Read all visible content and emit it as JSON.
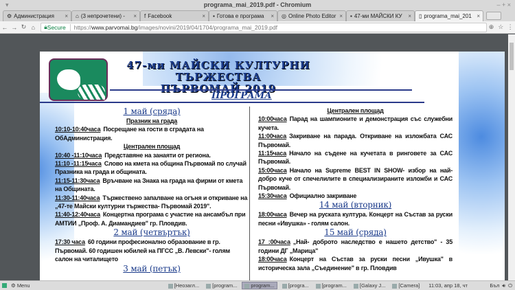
{
  "window": {
    "title": "programa_mai_2019.pdf - Chromium",
    "controls": "– + ×"
  },
  "tabs": [
    {
      "label": "Администрация",
      "icon": "gear-icon"
    },
    {
      "label": "(3 непрочетени) - ",
      "icon": "home-icon"
    },
    {
      "label": "Facebook",
      "icon": "facebook-icon"
    },
    {
      "label": "Готова е програма",
      "icon": "page-icon"
    },
    {
      "label": "Online Photo Editor",
      "icon": "globe-icon"
    },
    {
      "label": "47-ми МАЙСКИ КУ",
      "icon": "page-icon"
    },
    {
      "label": "programa_mai_201",
      "icon": "document-icon",
      "active": true
    }
  ],
  "address": {
    "secure": "Secure",
    "url_scheme": "https://",
    "url_host": "www.parvomai.bg",
    "url_path": "/images/novini/2019/04/1704/programa_mai_2019.pdf"
  },
  "pdf": {
    "heading1": "47-ми МАЙСКИ КУЛТУРНИ ТЪРЖЕСТВА",
    "heading2": "ПЪРВОМАЙ 2019",
    "program": "ПРОГРАМА",
    "left": [
      {
        "type": "day",
        "text": "1 май  (сряда)"
      },
      {
        "type": "sub",
        "text": "Празник на града"
      },
      {
        "type": "item",
        "time": "10:10-10:40часа",
        "text": "Посрещане на гости в сградата на ОбАдминистрация."
      },
      {
        "type": "sub",
        "text": "Централен площад"
      },
      {
        "type": "item",
        "time": "10:40 -11:10часа",
        "text": "Представяне на занаяти от региона."
      },
      {
        "type": "item",
        "time": "11:10 -11:15часа",
        "text": "Слово на кмета на община Първомай по случай Празника на града и общината."
      },
      {
        "type": "item",
        "time": "11:15-11:30часа",
        "text": "Връчване на Знака на града на фирми от кмета на Общината."
      },
      {
        "type": "item",
        "time": "11:30-11:40часа",
        "text": "Тържествено запалване на огъня и откриване на „47-те Майски културни тържества- Първомай 2019\"."
      },
      {
        "type": "item",
        "time": "11:40-12:40часа",
        "text": "Концертна програма с участие на ансамбъл при АМТИИ „Проф. А. Диамандиев\" гр. Пловдив."
      },
      {
        "type": "day",
        "text": "2 май  (четвъртък)"
      },
      {
        "type": "item",
        "time": "17:30 часа",
        "text": "60 години професионално образование в гр. Първомай. 60 годишен юбилей на ПГСС „В. Левски\"- голям салон на читалището"
      },
      {
        "type": "day",
        "text": "3 май  (петък)"
      }
    ],
    "right": [
      {
        "type": "sub",
        "text": "Централен площад"
      },
      {
        "type": "item",
        "time": "10:00часа",
        "text": "Парад на шампионите и демонстрация със служебни кучета."
      },
      {
        "type": "item",
        "time": "11:00часа",
        "text": "Закриване на парада. Откриване на изложбата САС Първомай."
      },
      {
        "type": "item",
        "time": "11:15часа",
        "text": "Начало на съдене на кучетата в ринговете за САС Първомай."
      },
      {
        "type": "item",
        "time": "15:00часа",
        "text": "Начало на Supreme BEST IN SHOW- избор на най-добро куче от спечелилите в специализираните изложби и САС Първомай."
      },
      {
        "type": "item",
        "time": "15:30часа",
        "text": "Официално закриване"
      },
      {
        "type": "day",
        "text": "14 май  (вторник)"
      },
      {
        "type": "item",
        "time": "18:00часа",
        "text": "Вечер на руската култура. Концерт на Състав за руски песни «Ивушка» - голям салон."
      },
      {
        "type": "day",
        "text": "15 май  (сряда)"
      },
      {
        "type": "item",
        "time": "17 :00часа",
        "text": "„Най- доброто наследство е нашето детство\" - 35 години ДГ „Марица\""
      },
      {
        "type": "item",
        "time": "18:00часа",
        "text": "Концерт на Състав за руски песни „Ивушка\" в историческа зала „Съединение\" в гр. Пловдив"
      }
    ]
  },
  "taskbar": {
    "menu": "Menu",
    "items": [
      "[Неозагл...",
      "[program...",
      "program...",
      "[progra...",
      "[program...",
      "[Galaxy J...",
      "[Camera]"
    ],
    "active_index": 2,
    "clock": "11:03, апр 18, чт",
    "lang": "Бъл"
  }
}
